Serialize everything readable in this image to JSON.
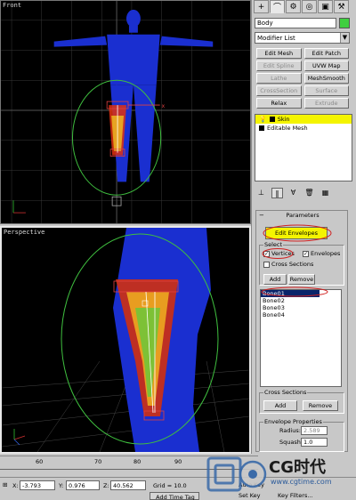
{
  "viewports": {
    "front": {
      "label": "Front"
    },
    "perspective": {
      "label": "Perspective"
    }
  },
  "panel": {
    "tabs": [
      "+",
      "⌒",
      "⚙",
      "◎",
      "▣",
      "⚒"
    ],
    "object_name": "Body",
    "object_color": "#3fcf3f",
    "modifier_list": "Modifier List",
    "modifier_buttons": [
      {
        "label": "Edit Mesh",
        "enabled": true
      },
      {
        "label": "Edit Patch",
        "enabled": true
      },
      {
        "label": "Edit Spline",
        "enabled": false
      },
      {
        "label": "UVW Map",
        "enabled": true
      },
      {
        "label": "Lathe",
        "enabled": false
      },
      {
        "label": "MeshSmooth",
        "enabled": true
      },
      {
        "label": "CrossSection",
        "enabled": false
      },
      {
        "label": "Surface",
        "enabled": false
      },
      {
        "label": "Relax",
        "enabled": true
      },
      {
        "label": "Extrude",
        "enabled": false
      }
    ],
    "stack": [
      {
        "label": "Skin",
        "selected": true
      },
      {
        "label": "Editable Mesh",
        "selected": false
      }
    ],
    "parameters": {
      "title": "Parameters",
      "edit_envelopes": "Edit Envelopes",
      "select_group": "Select",
      "vertices": "Vertices",
      "envelopes": "Envelopes",
      "cross_sections": "Cross Sections",
      "add": "Add",
      "remove": "Remove",
      "bones": [
        "Bone01",
        "Bone02",
        "Bone03",
        "Bone04"
      ],
      "cross_group": "Cross Sections",
      "cs_add": "Add",
      "cs_remove": "Remove",
      "env_group": "Envelope Properties",
      "radius_label": "Radius:",
      "radius_value": "2.589",
      "squash_label": "Squash:",
      "squash_value": "1.0"
    }
  },
  "timeline": {
    "ticks": [
      "60",
      "70",
      "80",
      "90"
    ]
  },
  "status": {
    "x_label": "X:",
    "x_value": "-3.793",
    "y_label": "Y:",
    "y_value": "0.976",
    "z_label": "Z:",
    "z_value": "40.562",
    "grid": "Grid = 10.0",
    "add_time_tag": "Add Time Tag",
    "auto_key": "Auto Key",
    "set_key": "Set Key",
    "key_filters": "Key Filters...",
    "watermark_brand": "CG时代",
    "watermark_url": "www.cgtime.com"
  },
  "colors": {
    "mesh_blue": "#1a2fd0",
    "highlight_yellow": "#f4f400",
    "envelope_green": "#3fbf3f",
    "annotation_red": "#d02020"
  }
}
